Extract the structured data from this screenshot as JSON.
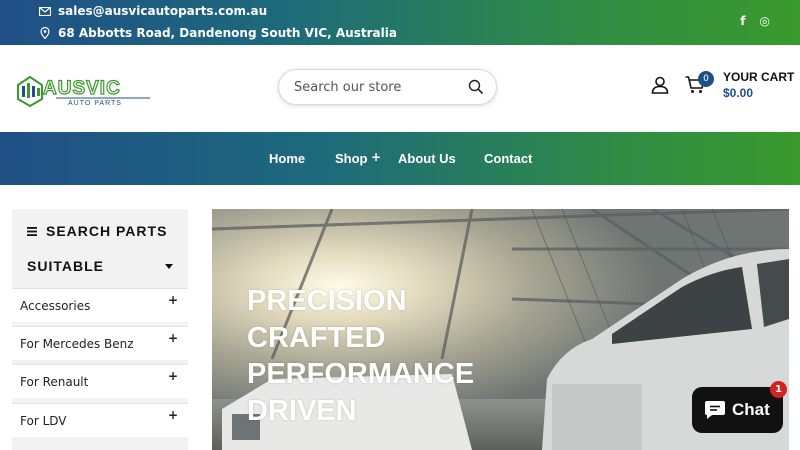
{
  "topbar": {
    "email": "sales@ausvicautoparts.com.au",
    "address": "68 Abbotts Road, Dandenong South VIC, Australia",
    "social": [
      "f",
      "◎"
    ]
  },
  "header": {
    "logo_brand": "AUSVIC",
    "logo_tagline": "AUTO PARTS",
    "search_placeholder": "Search our store",
    "cart_count": "0",
    "cart_label": "YOUR CART",
    "cart_total": "$0.00"
  },
  "nav": {
    "items": [
      "Home",
      "Shop",
      "About Us",
      "Contact"
    ],
    "shop_expand": "+"
  },
  "sidebar": {
    "title": "SEARCH PARTS",
    "subtitle": "SUITABLE",
    "items": [
      {
        "label": "Accessories",
        "expand": "+"
      },
      {
        "label": "For Mercedes Benz",
        "expand": "+"
      },
      {
        "label": "For Renault",
        "expand": "+"
      },
      {
        "label": "For LDV",
        "expand": "+"
      }
    ]
  },
  "hero": {
    "lines": [
      "PRECISION",
      "CRAFTED",
      "PERFORMANCE",
      "DRIVEN"
    ]
  },
  "chat": {
    "label": "Chat",
    "badge": "1"
  },
  "colors": {
    "brand_blue": "#1f4f86",
    "brand_green": "#3a9a2c",
    "chat_bg": "#111111",
    "badge_red": "#d6221f"
  },
  "icons": {
    "email": "mail-icon",
    "address": "map-pin-icon",
    "facebook": "facebook-icon",
    "instagram": "instagram-icon",
    "search": "search-icon",
    "account": "user-icon",
    "cart": "cart-icon",
    "menu": "menu-icon",
    "dropdown": "caret-down-icon",
    "chat": "chat-bubble-icon"
  }
}
